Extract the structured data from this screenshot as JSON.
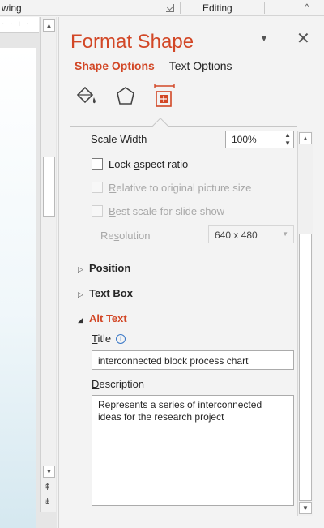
{
  "ribbon": {
    "group_left": "wing",
    "group_editing": "Editing",
    "collapse_glyph": "^"
  },
  "ruler": {
    "ticks": "· · ı ·"
  },
  "left_scroll": {
    "up": "▲",
    "down": "▼",
    "prev": "⇞",
    "next": "⇟"
  },
  "pane": {
    "title": "Format Shape",
    "dropdown_glyph": "▼",
    "close_glyph": "✕",
    "tabs": [
      {
        "label": "Shape Options",
        "active": true
      },
      {
        "label": "Text Options",
        "active": false
      }
    ],
    "icons": [
      "fill-line-icon",
      "effects-icon",
      "size-properties-icon"
    ],
    "accent_color": "#d24726"
  },
  "size": {
    "scale_width_label": "Scale ",
    "scale_width_u": "W",
    "scale_width_rest": "idth",
    "scale_width_value": "100%",
    "lock_pre": "Lock ",
    "lock_u": "a",
    "lock_rest": "spect ratio",
    "relative_u": "R",
    "relative_rest": "elative to original picture size",
    "best_u": "B",
    "best_rest": "est scale for slide show",
    "resolution_pre": "Re",
    "resolution_u": "s",
    "resolution_rest": "olution",
    "resolution_value": "640 x 480"
  },
  "sections": {
    "position": "Position",
    "text_box": "Text Box",
    "alt_text": "Alt Text"
  },
  "alt_text": {
    "title_u": "T",
    "title_rest": "itle",
    "info_glyph": "i",
    "title_value": "interconnected block process chart",
    "description_u": "D",
    "description_rest": "escription",
    "description_value": "Represents a series of interconnected ideas for the research project"
  },
  "right_scroll": {
    "up": "▲",
    "down": "▼"
  }
}
